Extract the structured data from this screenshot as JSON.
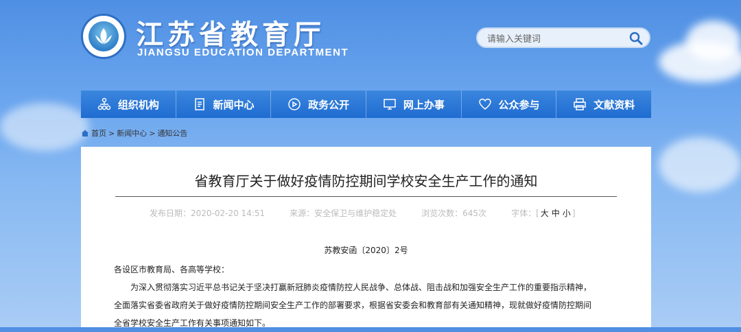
{
  "header": {
    "title": "江苏省教育厅",
    "subtitle": "JIANGSU EDUCATION DEPARTMENT",
    "search_placeholder": "请输入关键词"
  },
  "nav": {
    "items": [
      {
        "label": "组织机构",
        "icon": "org-chart-icon"
      },
      {
        "label": "新闻中心",
        "icon": "document-icon"
      },
      {
        "label": "政务公开",
        "icon": "eye-icon"
      },
      {
        "label": "网上办事",
        "icon": "monitor-icon"
      },
      {
        "label": "公众参与",
        "icon": "heart-icon"
      },
      {
        "label": "文献资料",
        "icon": "printer-icon"
      }
    ]
  },
  "breadcrumb": {
    "home": "首页",
    "sep": ">",
    "level1": "新闻中心",
    "level2": "通知公告"
  },
  "article": {
    "title": "省教育厅关于做好疫情防控期间学校安全生产工作的通知",
    "publish_date": "发布日期：2020-02-20 14:51",
    "source": "来源：安全保卫与维护稳定处",
    "views": "浏览次数：645次",
    "font_size_label": "字体：",
    "font_large": "大",
    "font_medium": "中",
    "font_small": "小",
    "doc_number": "苏教安函〔2020〕2号",
    "recipient": "各设区市教育局、各高等学校：",
    "para1": "为深入贯彻落实习近平总书记关于坚决打赢新冠肺炎疫情防控人民战争、总体战、阻击战和加强安全生产工作的重要指示精神，",
    "para2": "全面落实省委省政府关于做好疫情防控期间安全生产工作的部署要求，根据省安委会和教育部有关通知精神，现就做好疫情防控期间",
    "para3": "全省学校安全生产工作有关事项通知如下。"
  },
  "colors": {
    "nav_bg": "#1f6cd1",
    "sky": "#6aa5ee"
  }
}
